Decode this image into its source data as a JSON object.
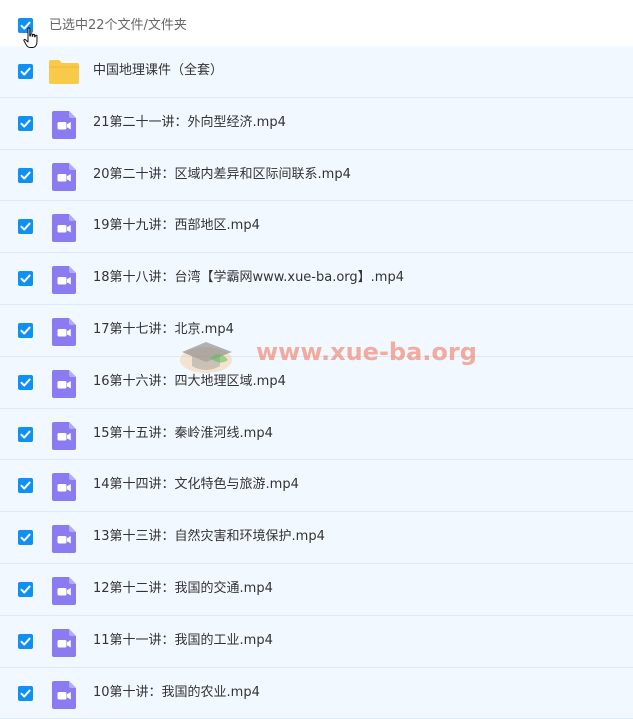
{
  "header": {
    "selection_label": "已选中22个文件/文件夹",
    "select_all_checked": true
  },
  "rows": [
    {
      "type": "folder",
      "name": "中国地理课件（全套）",
      "checked": true,
      "icon": "folder-icon"
    },
    {
      "type": "video",
      "name": "21第二十一讲：外向型经济.mp4",
      "checked": true,
      "icon": "video-file-icon"
    },
    {
      "type": "video",
      "name": "20第二十讲：区域内差异和区际间联系.mp4",
      "checked": true,
      "icon": "video-file-icon"
    },
    {
      "type": "video",
      "name": "19第十九讲：西部地区.mp4",
      "checked": true,
      "icon": "video-file-icon"
    },
    {
      "type": "video",
      "name": "18第十八讲：台湾【学霸网www.xue-ba.org】.mp4",
      "checked": true,
      "icon": "video-file-icon"
    },
    {
      "type": "video",
      "name": "17第十七讲：北京.mp4",
      "checked": true,
      "icon": "video-file-icon"
    },
    {
      "type": "video",
      "name": "16第十六讲：四大地理区域.mp4",
      "checked": true,
      "icon": "video-file-icon"
    },
    {
      "type": "video",
      "name": "15第十五讲：秦岭淮河线.mp4",
      "checked": true,
      "icon": "video-file-icon"
    },
    {
      "type": "video",
      "name": "14第十四讲：文化特色与旅游.mp4",
      "checked": true,
      "icon": "video-file-icon"
    },
    {
      "type": "video",
      "name": "13第十三讲：自然灾害和环境保护.mp4",
      "checked": true,
      "icon": "video-file-icon"
    },
    {
      "type": "video",
      "name": "12第十二讲：我国的交通.mp4",
      "checked": true,
      "icon": "video-file-icon"
    },
    {
      "type": "video",
      "name": "11第十一讲：我国的工业.mp4",
      "checked": true,
      "icon": "video-file-icon"
    },
    {
      "type": "video",
      "name": "10第十讲：我国的农业.mp4",
      "checked": true,
      "icon": "video-file-icon"
    }
  ],
  "watermark": {
    "text": "www.xue-ba.org"
  },
  "colors": {
    "checkbox": "#0f91f1",
    "row_background": "#f2f8ff",
    "row_divider": "#dce9f7",
    "video_icon": "#8a7cf0",
    "folder_icon": "#f9c94a",
    "watermark": "#f06e50"
  }
}
